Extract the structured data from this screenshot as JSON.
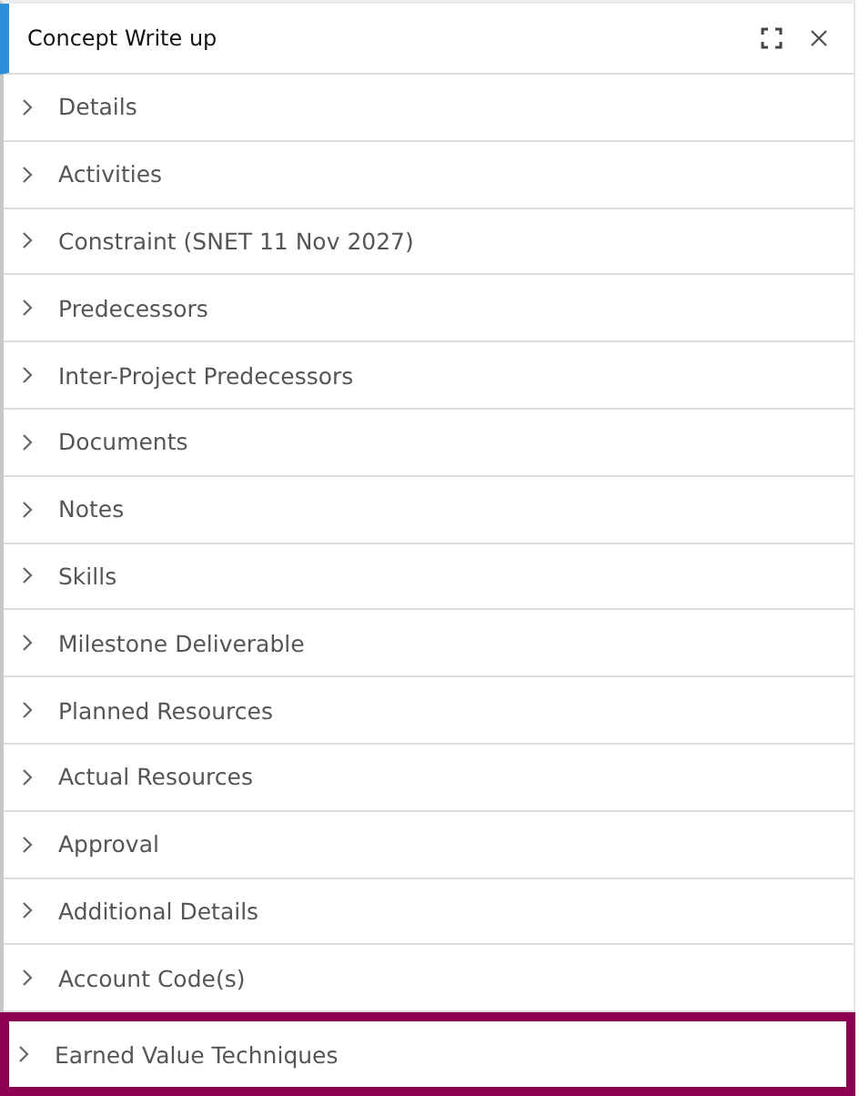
{
  "panel": {
    "title": "Concept Write up"
  },
  "sections": [
    {
      "label": "Details",
      "selected": false
    },
    {
      "label": "Activities",
      "selected": false
    },
    {
      "label": "Constraint (SNET 11 Nov 2027)",
      "selected": false
    },
    {
      "label": "Predecessors",
      "selected": false
    },
    {
      "label": "Inter-Project Predecessors",
      "selected": false
    },
    {
      "label": "Documents",
      "selected": false
    },
    {
      "label": "Notes",
      "selected": false
    },
    {
      "label": "Skills",
      "selected": false
    },
    {
      "label": "Milestone Deliverable",
      "selected": false
    },
    {
      "label": "Planned Resources",
      "selected": false
    },
    {
      "label": "Actual Resources",
      "selected": false
    },
    {
      "label": "Approval",
      "selected": false
    },
    {
      "label": "Additional Details",
      "selected": false
    },
    {
      "label": "Account Code(s)",
      "selected": false
    },
    {
      "label": "Earned Value Techniques",
      "selected": true
    }
  ]
}
